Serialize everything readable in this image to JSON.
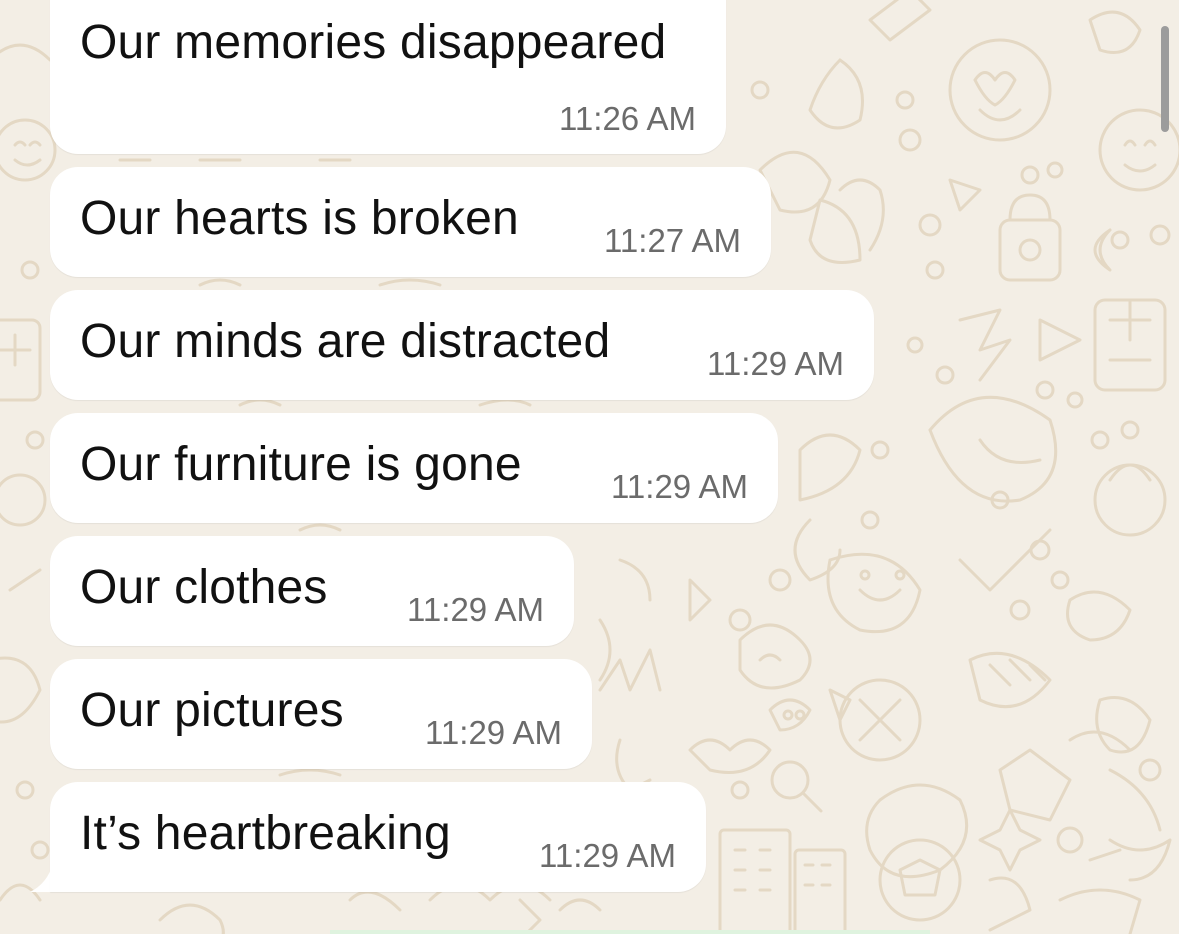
{
  "chat": {
    "messages": [
      {
        "text": "Our memories disappeared",
        "time": "11:26 AM"
      },
      {
        "text": "Our hearts is broken",
        "time": "11:27 AM"
      },
      {
        "text": "Our minds are distracted",
        "time": "11:29 AM"
      },
      {
        "text": "Our furniture is gone",
        "time": "11:29 AM"
      },
      {
        "text": "Our clothes",
        "time": "11:29 AM"
      },
      {
        "text": "Our pictures",
        "time": "11:29 AM"
      },
      {
        "text": "It’s heartbreaking",
        "time": "11:29 AM"
      }
    ]
  },
  "colors": {
    "wallpaper": "#f3eee5",
    "bubble": "#ffffff",
    "text": "#111111",
    "timestamp": "#6b6b6b"
  }
}
